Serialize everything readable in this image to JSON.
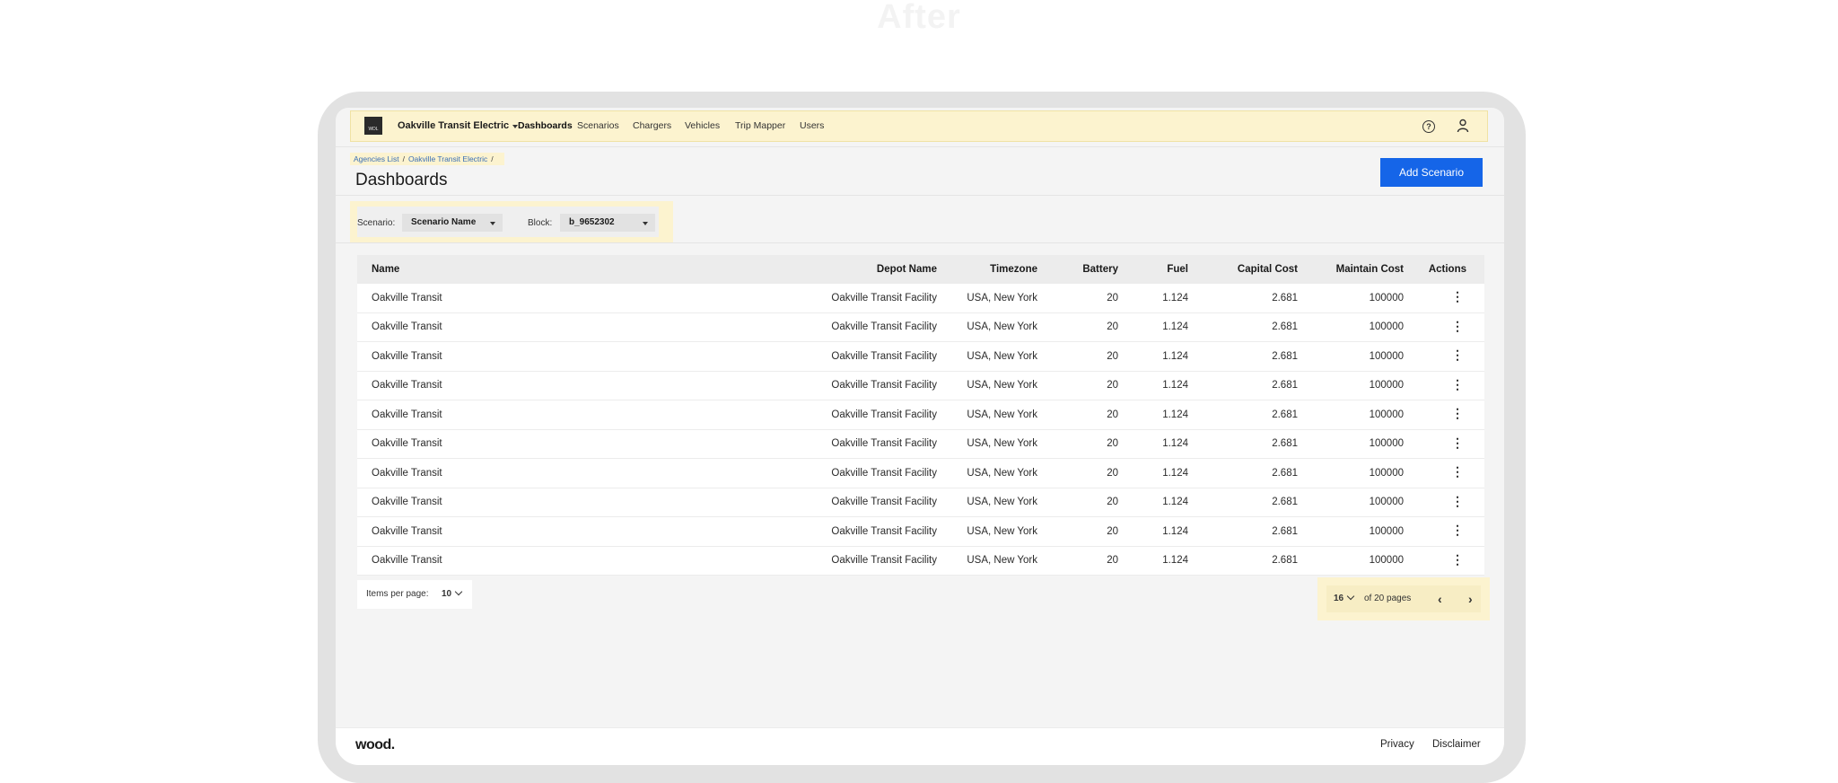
{
  "ghost_title": "After",
  "navbar": {
    "logo_text": "WDL",
    "agency_name": "Oakville Transit Electric",
    "items": [
      {
        "label": "Dashboards",
        "active": true
      },
      {
        "label": "Scenarios",
        "active": false
      },
      {
        "label": "Chargers",
        "active": false
      },
      {
        "label": "Vehicles",
        "active": false
      },
      {
        "label": "Trip Mapper",
        "active": false
      },
      {
        "label": "Users",
        "active": false
      }
    ],
    "help_icon": "help-circle-icon",
    "user_icon": "user-icon",
    "highlight_color": "#fcf3cf"
  },
  "breadcrumb": {
    "items": [
      "Agencies List",
      "Oakville Transit Electric"
    ],
    "separator": "/"
  },
  "page": {
    "title": "Dashboards",
    "add_button": "Add Scenario",
    "accent_color": "#1565e8"
  },
  "filters": {
    "scenario_label": "Scenario:",
    "scenario_value": "Scenario Name",
    "block_label": "Block:",
    "block_value": "b_9652302"
  },
  "table": {
    "columns": [
      "Name",
      "Depot Name",
      "Timezone",
      "Battery",
      "Fuel",
      "Capital Cost",
      "Maintain Cost",
      "Actions"
    ],
    "rows": [
      [
        "Oakville Transit",
        "Oakville Transit Facility",
        "USA, New York",
        "20",
        "1.124",
        "2.681",
        "100000"
      ],
      [
        "Oakville Transit",
        "Oakville Transit Facility",
        "USA, New York",
        "20",
        "1.124",
        "2.681",
        "100000"
      ],
      [
        "Oakville Transit",
        "Oakville Transit Facility",
        "USA, New York",
        "20",
        "1.124",
        "2.681",
        "100000"
      ],
      [
        "Oakville Transit",
        "Oakville Transit Facility",
        "USA, New York",
        "20",
        "1.124",
        "2.681",
        "100000"
      ],
      [
        "Oakville Transit",
        "Oakville Transit Facility",
        "USA, New York",
        "20",
        "1.124",
        "2.681",
        "100000"
      ],
      [
        "Oakville Transit",
        "Oakville Transit Facility",
        "USA, New York",
        "20",
        "1.124",
        "2.681",
        "100000"
      ],
      [
        "Oakville Transit",
        "Oakville Transit Facility",
        "USA, New York",
        "20",
        "1.124",
        "2.681",
        "100000"
      ],
      [
        "Oakville Transit",
        "Oakville Transit Facility",
        "USA, New York",
        "20",
        "1.124",
        "2.681",
        "100000"
      ],
      [
        "Oakville Transit",
        "Oakville Transit Facility",
        "USA, New York",
        "20",
        "1.124",
        "2.681",
        "100000"
      ],
      [
        "Oakville Transit",
        "Oakville Transit Facility",
        "USA, New York",
        "20",
        "1.124",
        "2.681",
        "100000"
      ]
    ],
    "action_icon": "more-vertical-icon"
  },
  "pagination": {
    "items_per_page_label": "Items per page:",
    "items_per_page_value": "10",
    "current_page": "16",
    "total_label": "of 20 pages",
    "prev_icon": "chevron-left-icon",
    "next_icon": "chevron-right-icon"
  },
  "footer": {
    "logo": "wood.",
    "links": [
      "Privacy",
      "Disclaimer"
    ]
  }
}
